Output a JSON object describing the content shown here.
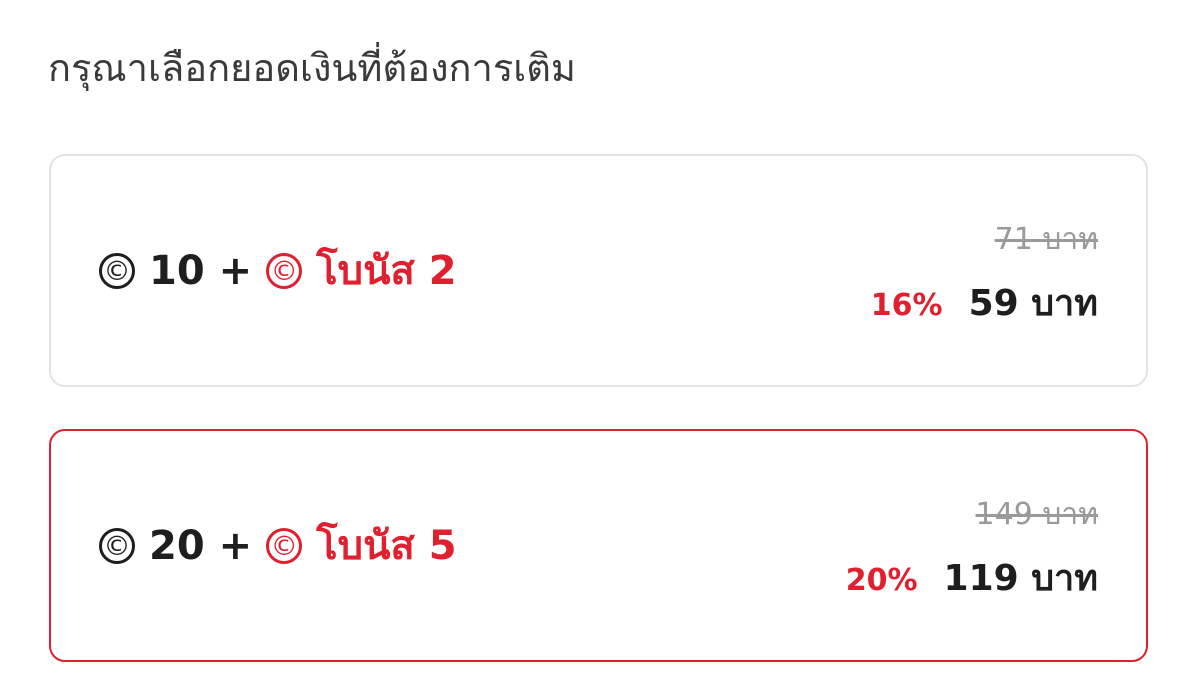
{
  "header": {
    "title": "กรุณาเลือกยอดเงินที่ต้องการเติม"
  },
  "colors": {
    "accent": "#e0202e",
    "border": "#e3e3e3",
    "text": "#1e1e1e",
    "muted": "#9a9a9a"
  },
  "packages": [
    {
      "coin_symbol": "©",
      "amount": "10",
      "plus": "+",
      "bonus_symbol": "©",
      "bonus": "โบนัส 2",
      "old_price": "71 บาท",
      "discount": "16%",
      "price": "59 บาท",
      "selected": false
    },
    {
      "coin_symbol": "©",
      "amount": "20",
      "plus": "+",
      "bonus_symbol": "©",
      "bonus": "โบนัส 5",
      "old_price": "149 บาท",
      "discount": "20%",
      "price": "119 บาท",
      "selected": true
    }
  ]
}
